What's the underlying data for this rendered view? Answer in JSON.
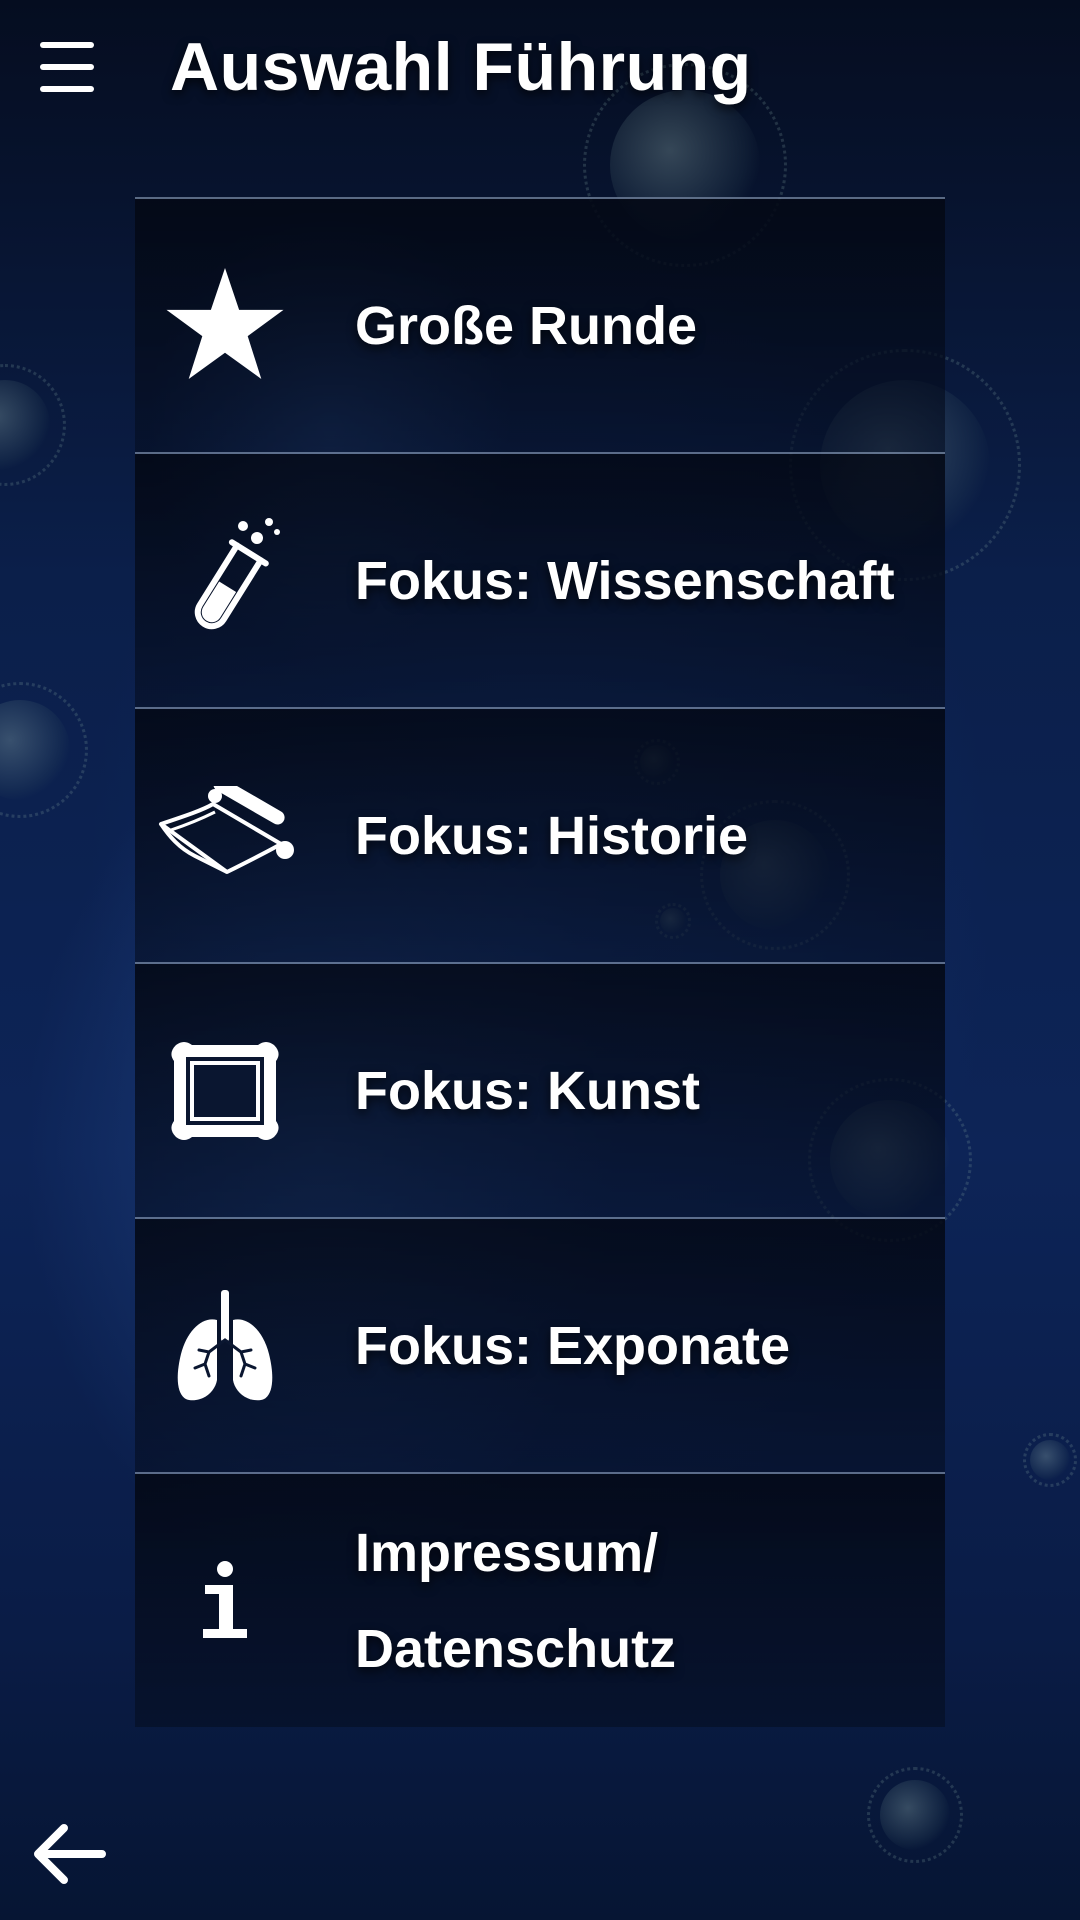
{
  "header": {
    "title": "Auswahl Führung",
    "menu_icon": "hamburger-menu-icon"
  },
  "menu": {
    "items": [
      {
        "label": "Große Runde",
        "icon": "star-icon"
      },
      {
        "label": "Fokus: Wissenschaft",
        "icon": "test-tube-icon"
      },
      {
        "label": "Fokus: Historie",
        "icon": "scroll-icon"
      },
      {
        "label": "Fokus: Kunst",
        "icon": "picture-frame-icon"
      },
      {
        "label": "Fokus: Exponate",
        "icon": "lungs-icon"
      },
      {
        "label": "Impressum/ Datenschutz",
        "icon": "info-icon"
      }
    ]
  },
  "footer": {
    "back_icon": "arrow-left-icon"
  },
  "colors": {
    "background": "#0b1f4a",
    "text": "#ffffff",
    "divider": "#a0b4d2"
  }
}
